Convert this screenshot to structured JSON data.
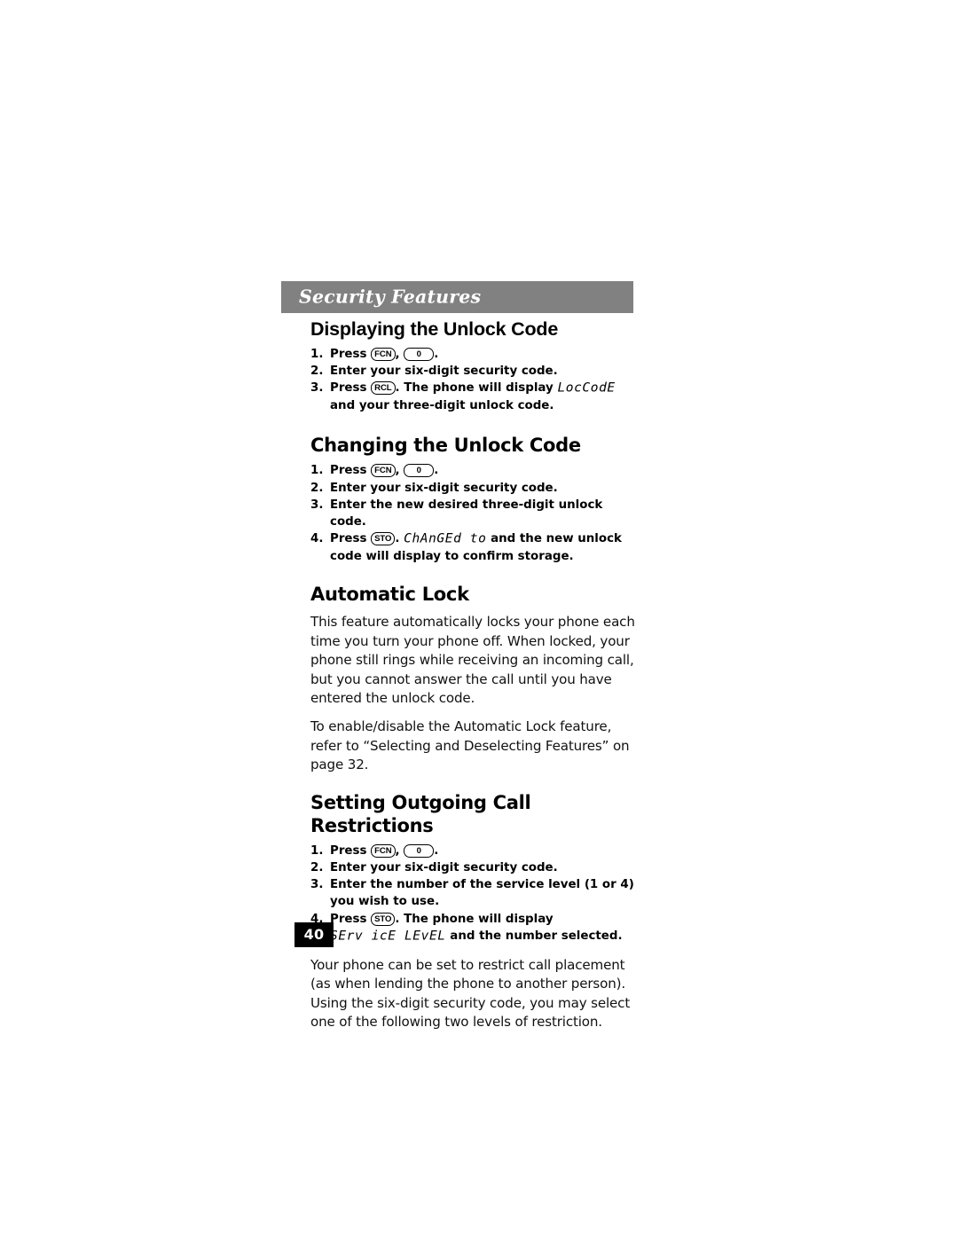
{
  "header": {
    "title": "Security Features"
  },
  "sections": [
    {
      "heading": "Displaying the Unlock Code",
      "steps": [
        {
          "num": "1.",
          "pre": "Press ",
          "keys": [
            "FCN",
            "0"
          ],
          "post": "."
        },
        {
          "num": "2.",
          "text": "Enter your six-digit security code."
        },
        {
          "num": "3.",
          "pre": "Press ",
          "keys": [
            "RCL"
          ],
          "mid": ". The phone will display ",
          "lcd": "LocCodE",
          "post": " and your three-digit unlock code."
        }
      ]
    },
    {
      "heading": "Changing the Unlock Code",
      "steps": [
        {
          "num": "1.",
          "pre": "Press ",
          "keys": [
            "FCN",
            "0"
          ],
          "post": "."
        },
        {
          "num": "2.",
          "text": "Enter your six-digit security code."
        },
        {
          "num": "3.",
          "text": "Enter the new desired three-digit unlock code."
        },
        {
          "num": "4.",
          "pre": "Press ",
          "keys": [
            "STO"
          ],
          "mid": ". ",
          "lcd": "ChAnGEd to",
          "post": " and the new unlock code will display to confirm storage."
        }
      ]
    },
    {
      "heading": "Automatic Lock",
      "paragraphs": [
        "This feature automatically locks your phone each time you turn your phone off. When locked, your phone still rings while receiving an incoming call, but you cannot answer the call until you have entered the unlock code.",
        "To enable/disable the Automatic Lock feature, refer to “Selecting and Deselecting Features” on page 32."
      ]
    },
    {
      "heading": "Setting Outgoing Call Restrictions",
      "steps": [
        {
          "num": "1.",
          "pre": "Press ",
          "keys": [
            "FCN",
            "0"
          ],
          "post": "."
        },
        {
          "num": "2.",
          "text": "Enter your six-digit security code."
        },
        {
          "num": "3.",
          "text": "Enter the number of the service level (1 or 4) you wish to use."
        },
        {
          "num": "4.",
          "pre": "Press ",
          "keys": [
            "STO"
          ],
          "mid": ". The phone will display ",
          "lcd": "SErv icE LEvEL",
          "post": " and the number selected."
        }
      ],
      "paragraphs": [
        "Your phone can be set to restrict call placement (as when lending the phone to another person). Using the six-digit security code, you may select one of the following two levels of restriction."
      ]
    }
  ],
  "folio": {
    "page_number": "40"
  },
  "colors": {
    "header_bar": "#818181",
    "header_text": "#ffffff",
    "folio_background": "#000000",
    "folio_text": "#ffffff",
    "body_text": "#111111"
  }
}
